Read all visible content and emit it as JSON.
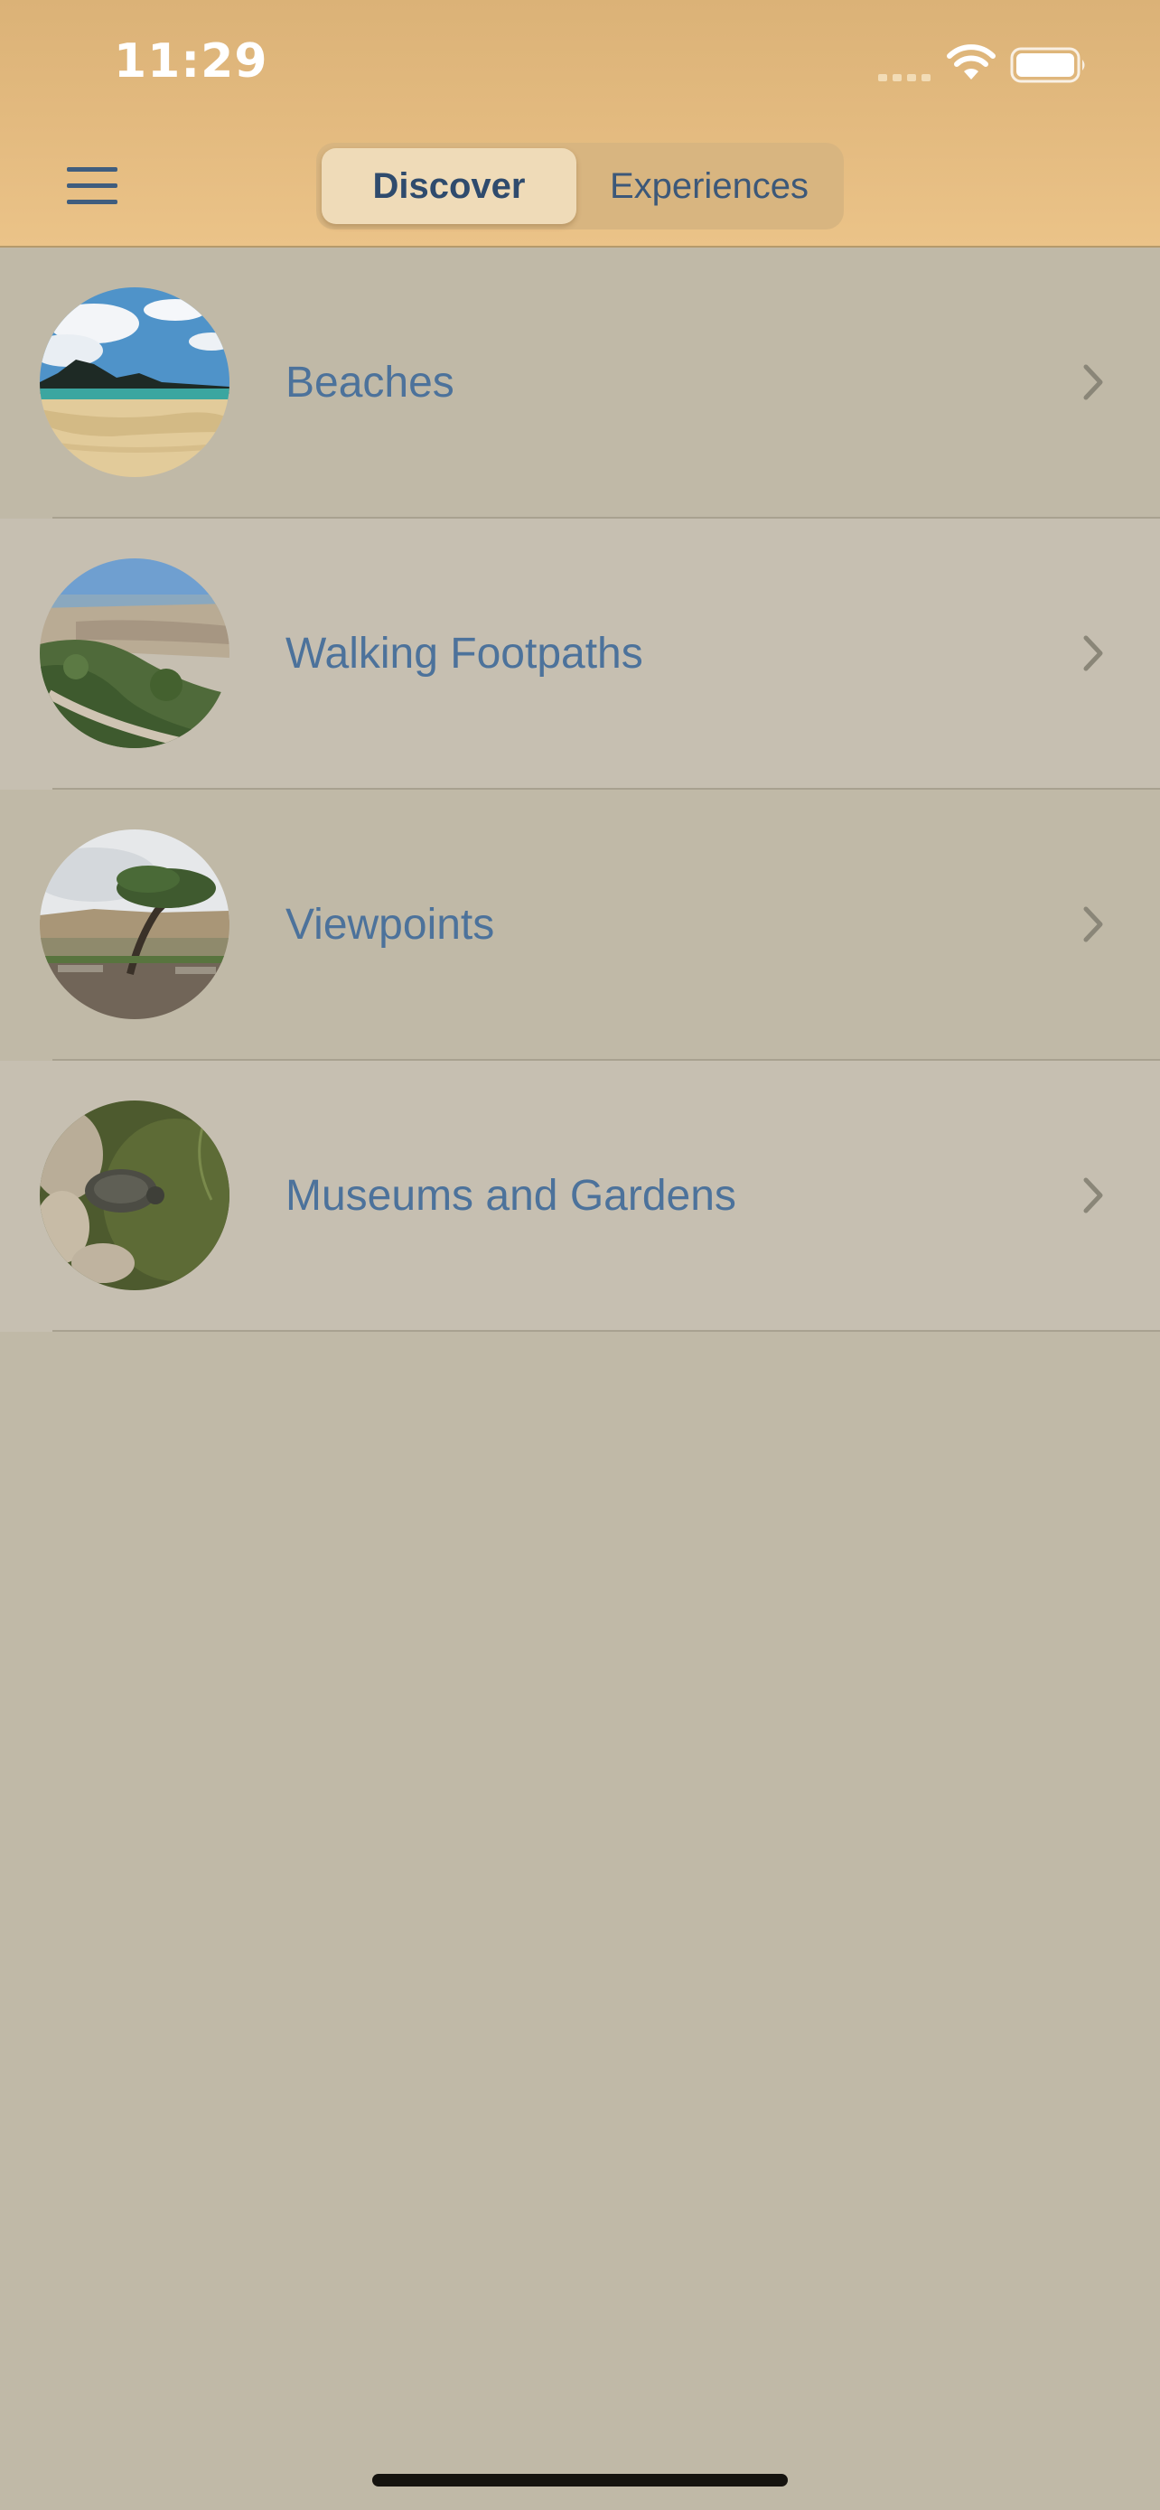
{
  "status_bar": {
    "time": "11:29",
    "icons": [
      "cellular-signal-icon",
      "wifi-icon",
      "battery-icon"
    ]
  },
  "nav": {
    "menu_icon": "hamburger-menu-icon",
    "segments": [
      {
        "label": "Discover",
        "selected": true
      },
      {
        "label": "Experiences",
        "selected": false
      }
    ]
  },
  "categories": [
    {
      "label": "Beaches",
      "thumbnail": "beach-photo"
    },
    {
      "label": "Walking Footpaths",
      "thumbnail": "footpath-photo"
    },
    {
      "label": "Viewpoints",
      "thumbnail": "viewpoint-photo"
    },
    {
      "label": "Museums and Gardens",
      "thumbnail": "garden-turtle-photo"
    }
  ],
  "colors": {
    "header_top": "#dbb277",
    "header_bottom": "#ebc388",
    "background": "#c0b9a7",
    "row_alt": "#c6bfb1",
    "link_text": "#4c729b",
    "segment_selected": "#efdbb8",
    "segment_bg": "#d8b580",
    "icon": "#3f5d7e"
  }
}
